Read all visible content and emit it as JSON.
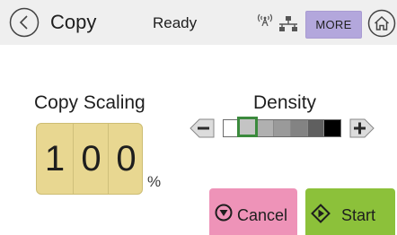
{
  "header": {
    "back_icon": "chevron-left-circle-icon",
    "title": "Copy",
    "status": "Ready",
    "wireless_icon": "wireless-signal-icon",
    "network_icon": "network-icon",
    "more_label": "MORE",
    "home_icon": "home-icon",
    "more_color": "#b3a7dc"
  },
  "copy_scaling": {
    "label": "Copy Scaling",
    "digits": [
      "1",
      "0",
      "0"
    ],
    "unit": "%",
    "box_color": "#e8d791"
  },
  "density": {
    "label": "Density",
    "minus_icon": "minus-icon",
    "plus_icon": "plus-icon",
    "levels": [
      "#ffffff",
      "#c4c4c4",
      "#b0b0b0",
      "#9a9a9a",
      "#838383",
      "#5f5f5f",
      "#000000"
    ],
    "selected_index": 1,
    "selected_color": "#3b8a3d"
  },
  "actions": {
    "cancel_label": "Cancel",
    "cancel_icon": "stop-icon",
    "cancel_color": "#ee93b8",
    "start_label": "Start",
    "start_icon": "start-icon",
    "start_color": "#8cc13a"
  }
}
